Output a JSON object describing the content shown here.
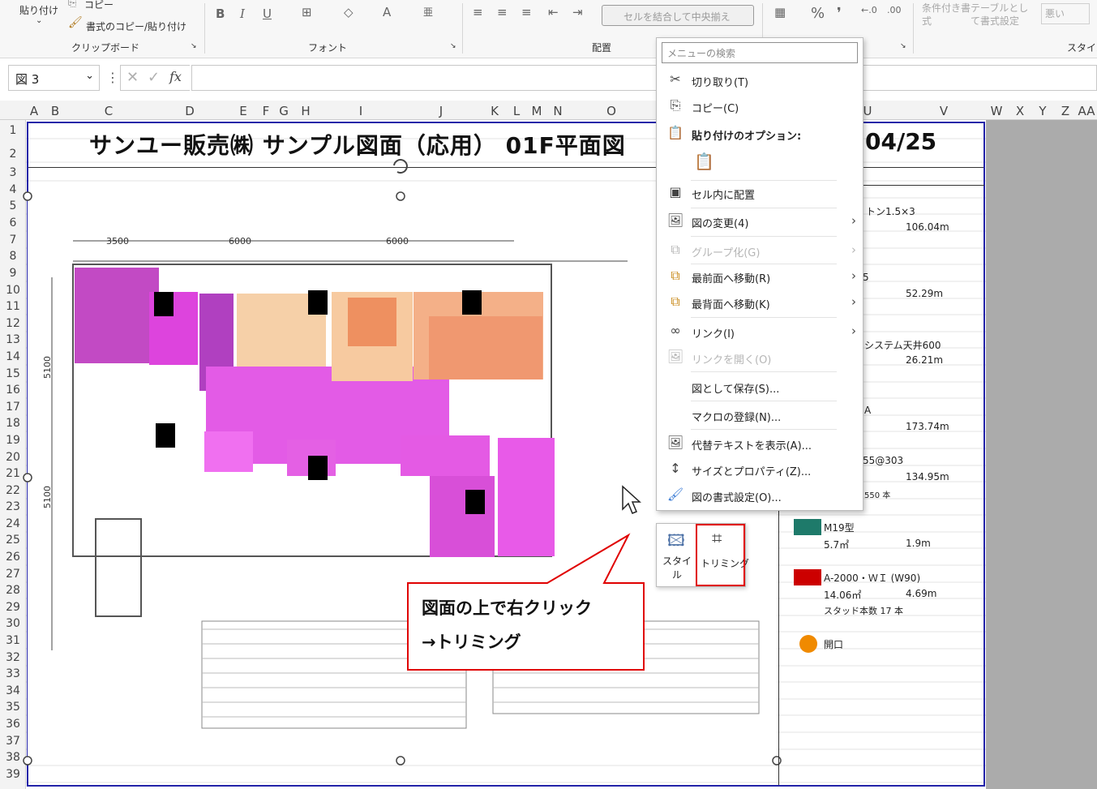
{
  "ribbon": {
    "paste_label": "貼り付け",
    "copy_label": "コピー",
    "format_painter_label": "書式のコピー/貼り付け",
    "group_clipboard": "クリップボード",
    "group_font": "フォント",
    "group_alignment": "配置",
    "group_style": "スタイル",
    "merge_label": "セルを結合して中央揃え",
    "conditional_format_label": "条件付き書式",
    "format_as_table_label": "テーブルとして書式設定",
    "style_bad_label": "悪い"
  },
  "formula_bar": {
    "name_box_value": "図 3",
    "fx_label": "fx",
    "formula_value": ""
  },
  "columns": [
    "A",
    "B",
    "C",
    "D",
    "E",
    "F",
    "G",
    "H",
    "I",
    "J",
    "K",
    "L",
    "M",
    "N",
    "O",
    "U",
    "V",
    "W",
    "X",
    "Y",
    "Z",
    "AA"
  ],
  "rows": [
    "1",
    "2",
    "3",
    "4",
    "5",
    "6",
    "7",
    "8",
    "9",
    "10",
    "11",
    "12",
    "13",
    "14",
    "15",
    "16",
    "17",
    "18",
    "19",
    "20",
    "21",
    "22",
    "23",
    "24",
    "25",
    "26",
    "27",
    "28",
    "29",
    "30",
    "31",
    "32",
    "33",
    "34",
    "35",
    "36",
    "37",
    "38",
    "39"
  ],
  "sheet": {
    "title": "サンユー販売㈱ サンプル図面（応用） 01F平面図",
    "title_date": "04/25",
    "plan_dims": [
      "3500",
      "6000",
      "6000",
      "5100",
      "5100"
    ]
  },
  "legend": {
    "items": [
      {
        "text": "トン1.5×3",
        "value": "106.04m"
      },
      {
        "text": "5",
        "value": "52.29m"
      },
      {
        "text": "システム天井600",
        "value": "26.21m"
      },
      {
        "text": "A",
        "value": "173.74m"
      },
      {
        "text": "55@303",
        "value": "134.95m"
      },
      {
        "text": "550 本",
        "value": ""
      }
    ],
    "m19_label": "M19型",
    "m19_area": "5.7㎡",
    "m19_len": "1.9m",
    "a2000_label": "A-2000・ＷＩ (W90)",
    "a2000_area": "14.06㎡",
    "a2000_len": "4.69m",
    "stud_count": "スタッド本数 17 本",
    "opening_label": "開口",
    "colors": {
      "m19": "#1e7a6a",
      "a2000": "#cc0000",
      "opening": "#f08a00"
    }
  },
  "context_menu": {
    "search_placeholder": "メニューの検索",
    "cut": "切り取り(T)",
    "copy": "コピー(C)",
    "paste_options": "貼り付けのオプション:",
    "place_in_cell": "セル内に配置",
    "change_picture": "図の変更(4)",
    "group": "グループ化(G)",
    "bring_front": "最前面へ移動(R)",
    "send_back": "最背面へ移動(K)",
    "link": "リンク(I)",
    "open_link": "リンクを開く(O)",
    "save_as_picture": "図として保存(S)...",
    "assign_macro": "マクロの登録(N)...",
    "alt_text": "代替テキストを表示(A)...",
    "size_properties": "サイズとプロパティ(Z)...",
    "format_picture": "図の書式設定(O)..."
  },
  "mini_toolbar": {
    "style_label": "スタイル",
    "crop_label": "トリミング"
  },
  "callout": {
    "line1": "図面の上で右クリック",
    "line2": "→トリミング"
  }
}
